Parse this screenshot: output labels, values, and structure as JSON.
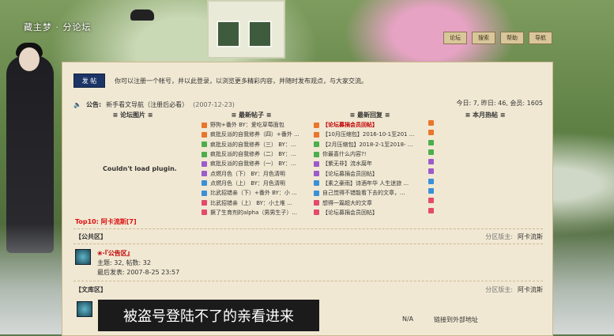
{
  "header": {
    "site_logo": "藏主梦 · 分论坛",
    "nav": [
      "论坛",
      "搜索",
      "帮助",
      "导航"
    ]
  },
  "panel": {
    "post_label": "发 帖",
    "notice_text": "你可以注册一个帐号，并以此登录，以浏览更多精彩内容，并随时发布观点，与大家交流。",
    "announcement_label": "公告:",
    "announcement": "新手看文导航（注册后必看）",
    "announcement_date": "(2007-12-23)",
    "stats": "今日: 7, 昨日: 46, 会员: 1605",
    "columns": [
      "≡ 论坛图片 ≡",
      "≡ 最新帖子 ≡",
      "≡ 最新回复 ≡",
      "≡ 本月热帖 ≡"
    ],
    "plugin_message": "Couldn't load plugin.",
    "latest_posts": [
      "野狗+番外 BY：爱吃草莓面包",
      "疯批反派的自我修养（四）+番外 ...",
      "疯批反派的自我修养（三） BY：...",
      "疯批反派的自我修养（二） BY：...",
      "疯批反派的自我修养（一） BY：...",
      "点燃月色（下） BY：月色清明",
      "点燃月色（上） BY：月色清明",
      "比武招错亲（下）+番外 BY：小 ...",
      "比武招错亲（上） BY：小土堆 ...",
      "撅了生育剂的alpha（男男生子）..."
    ],
    "latest_replies": [
      "【论坛募捐会员回帖】",
      "【10月压缩包】2016-10-1至201 ...",
      "【2月压缩包】2018-2-1至2018- ...",
      "你最喜什么内容?!",
      "【紫无非】流水腐年",
      "【论坛募捐会员回帖】",
      "【素之豪雨】诗酒年华 人生迷旅 ...",
      "自己觉得不错能看下去的文章，...",
      "想得一篇超大的文章",
      "【论坛募捐会员回帖】"
    ],
    "top10_label": "Top10: 阿卡流斯[7]",
    "sections": [
      {
        "title": "【公共区】",
        "moderator_label": "分区版主:",
        "moderator": "阿卡流斯",
        "forum_name": "❀·『公告区』",
        "forum_stats": "主题: 32, 帖数: 32",
        "last_post": "最后发表: 2007-8-25 23:57"
      },
      {
        "title": "【文库区】",
        "moderator_label": "分区版主:",
        "moderator": "阿卡流斯"
      }
    ],
    "na": "N/A",
    "external_link": "链接到外部地址",
    "subtitle": "被盗号登陆不了的亲看进来"
  },
  "colors": {
    "accent_red": "#c00000",
    "panel_bg": "#f1e8d3",
    "post_btn": "#1c3566"
  }
}
